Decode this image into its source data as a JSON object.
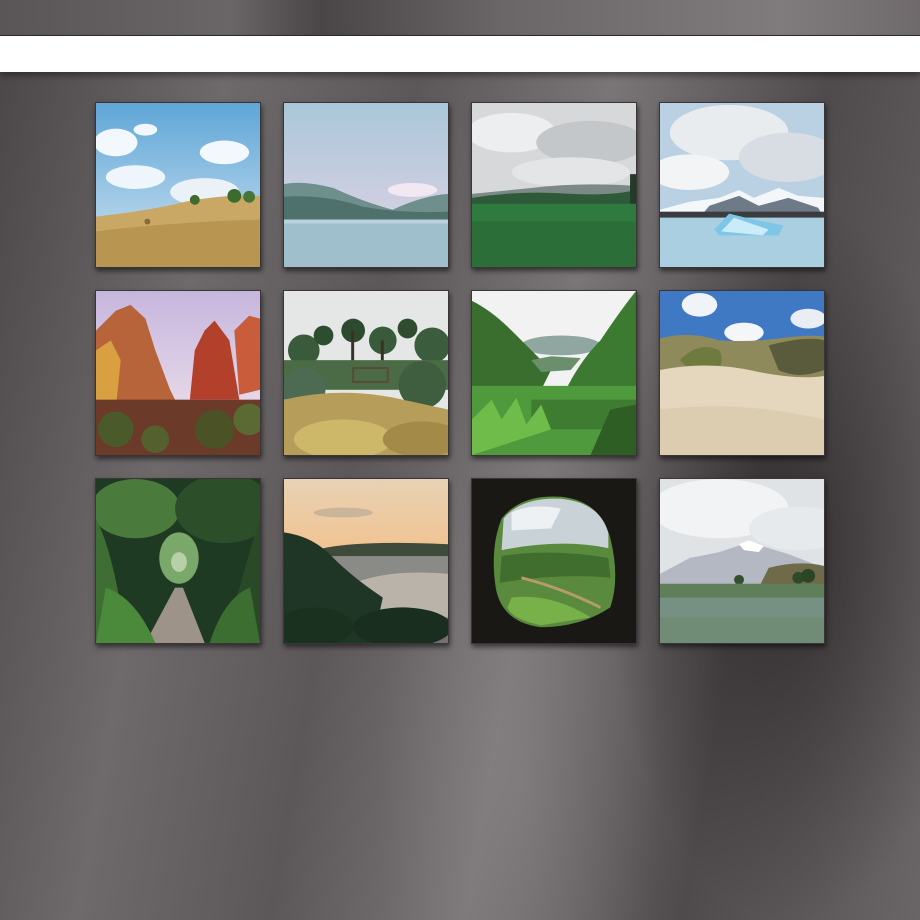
{
  "window": {
    "toolbar_placeholder": ""
  },
  "gallery": {
    "rows": 3,
    "columns": 4,
    "images": [
      {
        "scene": "wheat-field-hill-sky"
      },
      {
        "scene": "misty-lake-mountains"
      },
      {
        "scene": "green-meadow-cloudy-sky"
      },
      {
        "scene": "glacier-lagoon-icebergs"
      },
      {
        "scene": "red-rock-canyon"
      },
      {
        "scene": "garden-pine-trees"
      },
      {
        "scene": "jungle-valley-grass"
      },
      {
        "scene": "sand-dunes-blue-sky"
      },
      {
        "scene": "forest-tunnel-path"
      },
      {
        "scene": "coastal-sunset-cliff"
      },
      {
        "scene": "cave-opening-green-valley"
      },
      {
        "scene": "snow-mountain-lupin-field"
      }
    ]
  }
}
